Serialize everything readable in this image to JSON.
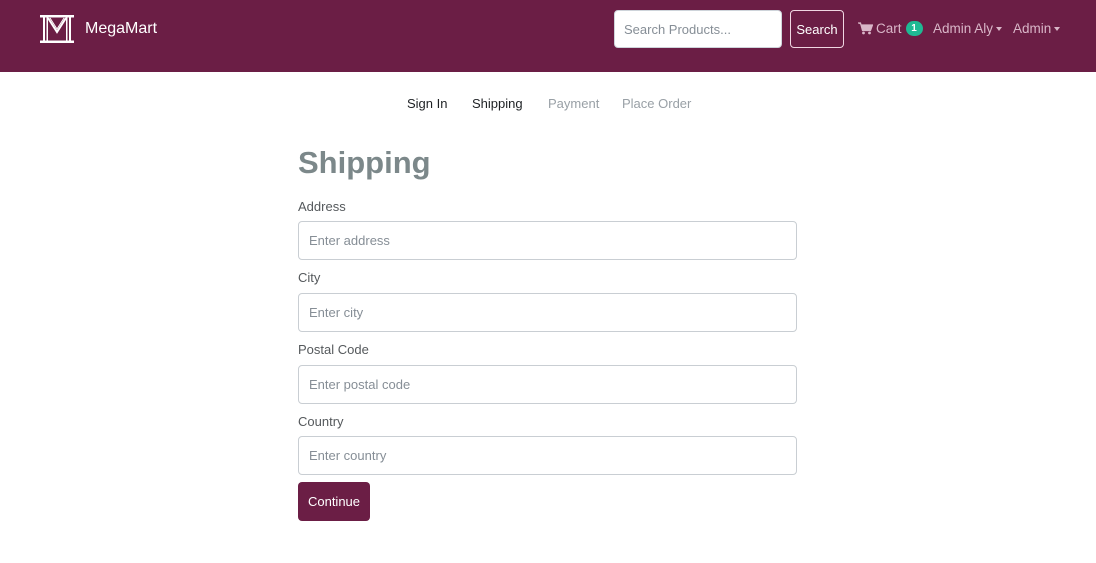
{
  "colors": {
    "navbar": "#6b1e45",
    "primary": "#6b1e45",
    "badge": "#1fb994",
    "title": "#7c888a"
  },
  "header": {
    "brand": {
      "icon": "megamart-logo-icon",
      "name": "MegaMart"
    },
    "search": {
      "placeholder": "Search Products...",
      "value": "",
      "button_label": "Search"
    },
    "cart": {
      "icon": "shopping-cart-icon",
      "label": "Cart",
      "count": "1"
    },
    "user_menu": {
      "label": "Admin Aly",
      "icon": "caret-down-icon"
    },
    "admin_menu": {
      "label": "Admin",
      "icon": "caret-down-icon"
    }
  },
  "checkout_steps": [
    {
      "label": "Sign In",
      "state": "enabled"
    },
    {
      "label": "Shipping",
      "state": "enabled"
    },
    {
      "label": "Payment",
      "state": "disabled"
    },
    {
      "label": "Place Order",
      "state": "disabled"
    }
  ],
  "form": {
    "title": "Shipping",
    "fields": [
      {
        "label": "Address",
        "placeholder": "Enter address",
        "value": ""
      },
      {
        "label": "City",
        "placeholder": "Enter city",
        "value": ""
      },
      {
        "label": "Postal Code",
        "placeholder": "Enter postal code",
        "value": ""
      },
      {
        "label": "Country",
        "placeholder": "Enter country",
        "value": ""
      }
    ],
    "submit_label": "Continue"
  }
}
